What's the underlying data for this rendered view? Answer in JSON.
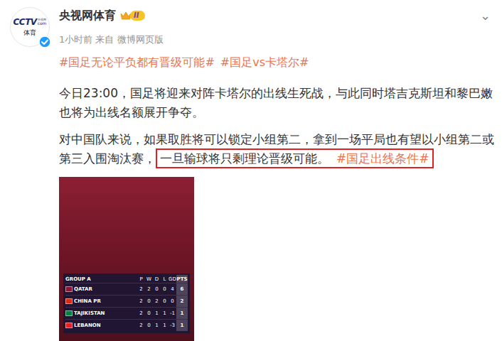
{
  "post": {
    "author": {
      "name": "央视网体育",
      "level_badge": "II",
      "verified": true,
      "avatar": {
        "logo": "CCTV",
        "logo_suffix": "com",
        "logo_caption": "央视网",
        "label": "体育"
      }
    },
    "meta": "1小时前 来自 微博网页版",
    "menu_icon": "⌄",
    "hashtags": [
      "#国足无论平负都有晋级可能#",
      "#国足vs卡塔尔#"
    ],
    "paragraphs": [
      [
        {
          "text": "今日23:00，国足将迎来对阵卡塔尔的出线生死战，与此同时塔吉克斯坦和黎巴嫩也将为出线名额展开争夺。",
          "kind": "plain",
          "highlighted": false
        }
      ],
      [
        {
          "text": "对中国队来说，如果取胜将可以锁定小组第二，拿到一场平局也有望以小组第二或第三入围淘汰赛，",
          "kind": "plain",
          "highlighted": false
        },
        {
          "text": "一旦输球将只剩理论晋级可能。",
          "kind": "plain",
          "highlighted": true
        },
        {
          "text": "#国足出线条件#",
          "kind": "tag",
          "highlighted": true
        }
      ]
    ],
    "image": {
      "standings": {
        "group": "GROUP A",
        "columns": [
          "P",
          "W",
          "D",
          "L",
          "GD",
          "PTS"
        ],
        "rows": [
          {
            "team": "QATAR",
            "values": [
              "2",
              "2",
              "0",
              "0",
              "4",
              "6"
            ],
            "color": "#8a1538"
          },
          {
            "team": "CHINA PR",
            "values": [
              "2",
              "0",
              "2",
              "0",
              "0",
              "2"
            ],
            "color": "#de2910"
          },
          {
            "team": "TAJIKISTAN",
            "values": [
              "2",
              "0",
              "1",
              "1",
              "-1",
              "1"
            ],
            "color": "#00813f"
          },
          {
            "team": "LEBANON",
            "values": [
              "2",
              "0",
              "1",
              "1",
              "-3",
              "1"
            ],
            "color": "#ed1c24"
          }
        ]
      }
    }
  }
}
